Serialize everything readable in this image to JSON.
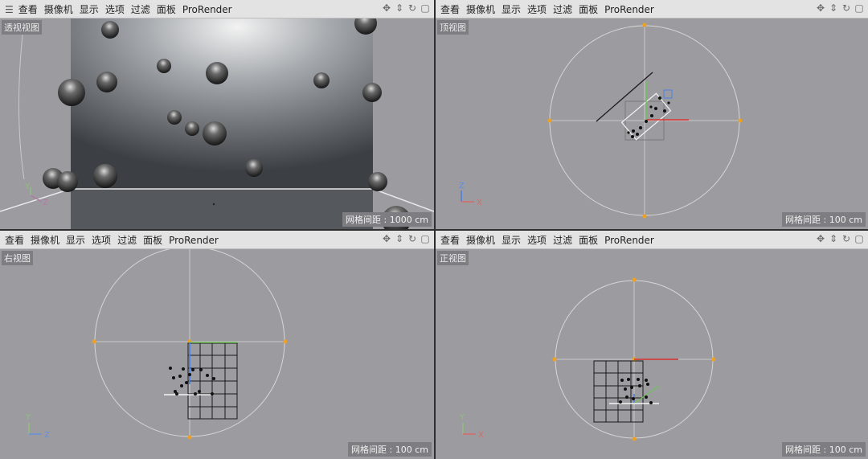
{
  "menu": {
    "items": [
      "查看",
      "摄像机",
      "显示",
      "选项",
      "过滤",
      "面板",
      "ProRender"
    ],
    "controls": [
      "move-view-icon",
      "zoom-view-icon",
      "rotate-view-icon",
      "maximize-view-icon"
    ]
  },
  "viewports": [
    {
      "label": "透视视图",
      "grid_label": "网格间距 : 1000 cm"
    },
    {
      "label": "顶视图",
      "grid_label": "网格间距 : 100 cm"
    },
    {
      "label": "右视图",
      "grid_label": "网格间距 : 100 cm"
    },
    {
      "label": "正视图",
      "grid_label": "网格间距 : 100 cm"
    }
  ],
  "axes": {
    "top": [
      "Z",
      "X"
    ],
    "right": [
      "Y",
      "Z"
    ],
    "front": [
      "Y",
      "X"
    ],
    "perspective": [
      "Y",
      "Z"
    ]
  }
}
